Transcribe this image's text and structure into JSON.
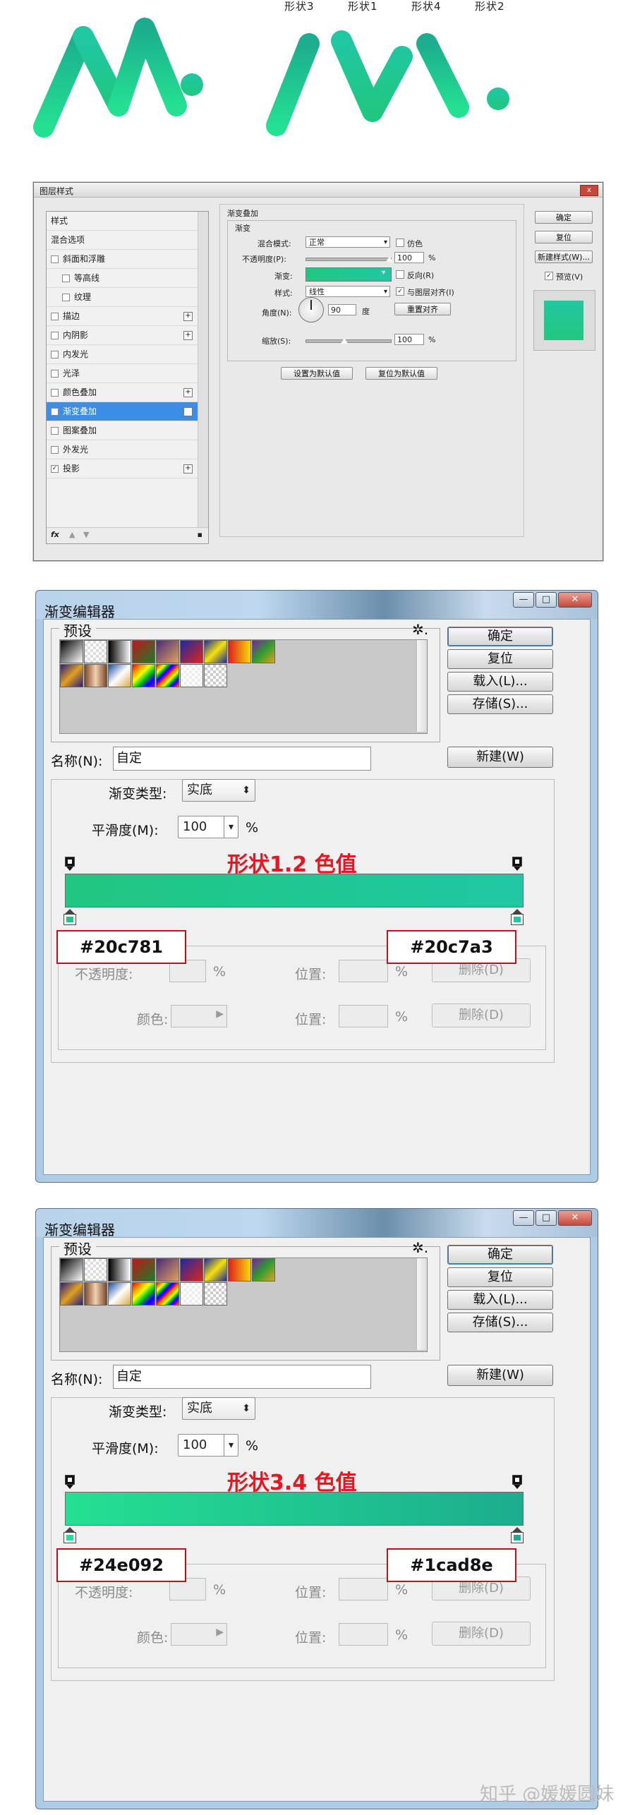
{
  "shapes": {
    "labels": [
      "形状3",
      "形状1",
      "形状4",
      "形状2"
    ],
    "gradient_start": "#20c781",
    "gradient_end": "#20c7a3"
  },
  "layer_style": {
    "title": "图层样式",
    "close_glyph": "x",
    "styles_list": [
      {
        "label": "样式",
        "checkbox": false,
        "plus": false,
        "sub": false,
        "checked": false
      },
      {
        "label": "混合选项",
        "checkbox": false,
        "plus": false,
        "sub": false,
        "checked": false
      },
      {
        "label": "斜面和浮雕",
        "checkbox": true,
        "plus": false,
        "sub": false,
        "checked": false
      },
      {
        "label": "等高线",
        "checkbox": true,
        "plus": false,
        "sub": true,
        "checked": false
      },
      {
        "label": "纹理",
        "checkbox": true,
        "plus": false,
        "sub": true,
        "checked": false
      },
      {
        "label": "描边",
        "checkbox": true,
        "plus": true,
        "sub": false,
        "checked": false
      },
      {
        "label": "内阴影",
        "checkbox": true,
        "plus": true,
        "sub": false,
        "checked": false
      },
      {
        "label": "内发光",
        "checkbox": true,
        "plus": false,
        "sub": false,
        "checked": false
      },
      {
        "label": "光泽",
        "checkbox": true,
        "plus": false,
        "sub": false,
        "checked": false
      },
      {
        "label": "颜色叠加",
        "checkbox": true,
        "plus": true,
        "sub": false,
        "checked": false
      },
      {
        "label": "渐变叠加",
        "checkbox": true,
        "plus": true,
        "sub": false,
        "checked": true,
        "selected": true
      },
      {
        "label": "图案叠加",
        "checkbox": true,
        "plus": false,
        "sub": false,
        "checked": false
      },
      {
        "label": "外发光",
        "checkbox": true,
        "plus": false,
        "sub": false,
        "checked": false
      },
      {
        "label": "投影",
        "checkbox": true,
        "plus": true,
        "sub": false,
        "checked": true
      }
    ],
    "fx_label": "fx",
    "section_title": "渐变叠加",
    "group_title": "渐变",
    "blend_mode_label": "混合模式:",
    "blend_mode_value": "正常",
    "dither_label": "仿色",
    "opacity_label": "不透明度(P):",
    "opacity_value": "100",
    "percent": "%",
    "gradient_label": "渐变:",
    "reverse_label": "反向(R)",
    "style_label": "样式:",
    "style_value": "线性",
    "align_label": "与图层对齐(I)",
    "angle_label": "角度(N):",
    "angle_value": "90",
    "degree_label": "度",
    "reset_align_button": "重置对齐",
    "scale_label": "缩放(S):",
    "scale_value": "100",
    "set_default_button": "设置为默认值",
    "reset_default_button": "复位为默认值",
    "ok_button": "确定",
    "reset_button": "复位",
    "new_style_button": "新建样式(W)...",
    "preview_label": "预览(V)",
    "preview_color": "#22c78f"
  },
  "gradient_editors": [
    {
      "title": "渐变编辑器",
      "presets_label": "预设",
      "gear_glyph": "✲.",
      "buttons": {
        "ok": "确定",
        "reset": "复位",
        "load": "载入(L)...",
        "save": "存储(S)..."
      },
      "name_label": "名称(N):",
      "name_value": "自定",
      "new_button": "新建(W)",
      "type_label": "渐变类型:",
      "type_value": "实底",
      "smooth_label": "平滑度(M):",
      "smooth_value": "100",
      "percent": "%",
      "overlay_title": "形状1.2 色值",
      "color_start": "#20c781",
      "color_end": "#20c7a3",
      "callout_left": "#20c781",
      "callout_right": "#20c7a3",
      "opacity_label_partial": "不透明度:",
      "position_label": "位置:",
      "delete_button": "删除(D)",
      "color_label": "颜色:"
    },
    {
      "title": "渐变编辑器",
      "presets_label": "预设",
      "gear_glyph": "✲.",
      "buttons": {
        "ok": "确定",
        "reset": "复位",
        "load": "载入(L)...",
        "save": "存储(S)..."
      },
      "name_label": "名称(N):",
      "name_value": "自定",
      "new_button": "新建(W)",
      "type_label": "渐变类型:",
      "type_value": "实底",
      "smooth_label": "平滑度(M):",
      "smooth_value": "100",
      "percent": "%",
      "overlay_title": "形状3.4 色值",
      "color_start": "#24e092",
      "color_end": "#1cad8e",
      "callout_left": "#24e092",
      "callout_right": "#1cad8e",
      "opacity_label_partial": "不透明度:",
      "position_label": "位置:",
      "delete_button": "删除(D)",
      "color_label": "颜色:"
    }
  ],
  "watermark": "知乎 @媛媛圆妹"
}
